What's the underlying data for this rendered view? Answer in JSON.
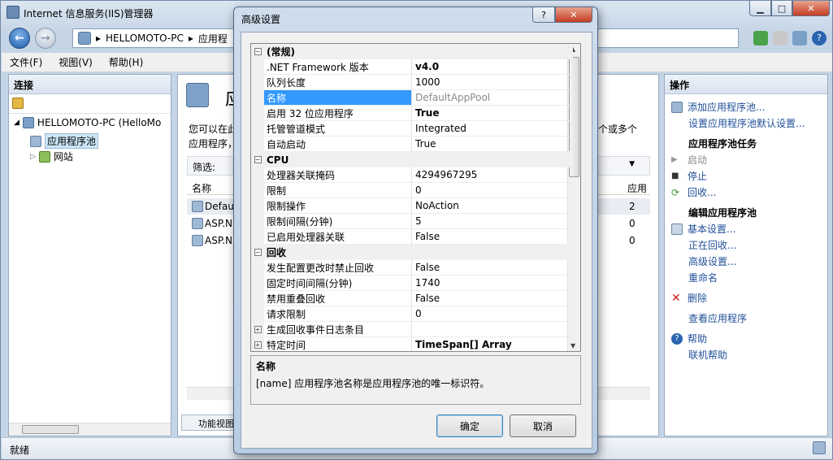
{
  "window": {
    "title": "Internet 信息服务(IIS)管理器"
  },
  "nav": {
    "breadcrumb": [
      "HELLOMOTO-PC",
      "应用程"
    ]
  },
  "menu": [
    "文件(F)",
    "视图(V)",
    "帮助(H)"
  ],
  "connections": {
    "header": "连接",
    "tree": [
      {
        "label": "HELLOMOTO-PC (HelloMo"
      },
      {
        "label": "应用程序池"
      },
      {
        "label": "网站"
      }
    ]
  },
  "center": {
    "title": "应",
    "desc1": "您可以在此",
    "desc2": "应用程序，",
    "desc_right": "个或多个",
    "filter_label": "筛选:",
    "col_name": "名称",
    "col_app": "应用",
    "rows": [
      {
        "name": "Defaul",
        "apps": "2"
      },
      {
        "name": "ASP.N",
        "apps": "0"
      },
      {
        "name": "ASP.N",
        "apps": "0"
      }
    ],
    "feature_view": "功能视图"
  },
  "actions": {
    "header": "操作",
    "add_pool": "添加应用程序池...",
    "set_defaults": "设置应用程序池默认设置...",
    "tasks_header": "应用程序池任务",
    "start": "启动",
    "stop": "停止",
    "recycle": "回收...",
    "edit_header": "编辑应用程序池",
    "basic_settings": "基本设置...",
    "recycling": "正在回收...",
    "advanced_settings": "高级设置...",
    "rename": "重命名",
    "delete": "删除",
    "view_apps": "查看应用程序",
    "help": "帮助",
    "online_help": "联机帮助"
  },
  "status": "就绪",
  "dialog": {
    "title": "高级设置",
    "help_btn": "?",
    "close_btn": "✕",
    "rows": [
      {
        "type": "cat",
        "name": "(常规)",
        "exp": "−"
      },
      {
        "name": ".NET Framework 版本",
        "value": "v4.0",
        "bold": true
      },
      {
        "name": "队列长度",
        "value": "1000"
      },
      {
        "name": "名称",
        "value": "DefaultAppPool",
        "selected": true
      },
      {
        "name": "启用 32 位应用程序",
        "value": "True",
        "bold": true
      },
      {
        "name": "托管管道模式",
        "value": "Integrated"
      },
      {
        "name": "自动启动",
        "value": "True"
      },
      {
        "type": "cat",
        "name": "CPU",
        "exp": "−"
      },
      {
        "name": "处理器关联掩码",
        "value": "4294967295"
      },
      {
        "name": "限制",
        "value": "0"
      },
      {
        "name": "限制操作",
        "value": "NoAction"
      },
      {
        "name": "限制间隔(分钟)",
        "value": "5"
      },
      {
        "name": "已启用处理器关联",
        "value": "False"
      },
      {
        "type": "cat",
        "name": "回收",
        "exp": "−"
      },
      {
        "name": "发生配置更改时禁止回收",
        "value": "False"
      },
      {
        "name": "固定时间间隔(分钟)",
        "value": "1740"
      },
      {
        "name": "禁用重叠回收",
        "value": "False"
      },
      {
        "name": "请求限制",
        "value": "0"
      },
      {
        "name": "生成回收事件日志条目",
        "value": "",
        "exp": "+"
      },
      {
        "name": "特定时间",
        "value": "TimeSpan[] Array",
        "bold": true,
        "exp": "+"
      }
    ],
    "desc_title": "名称",
    "desc_text": "[name] 应用程序池名称是应用程序池的唯一标识符。",
    "ok": "确定",
    "cancel": "取消"
  },
  "colors": {
    "accent": "#3399ff",
    "link": "#1f4f99"
  }
}
